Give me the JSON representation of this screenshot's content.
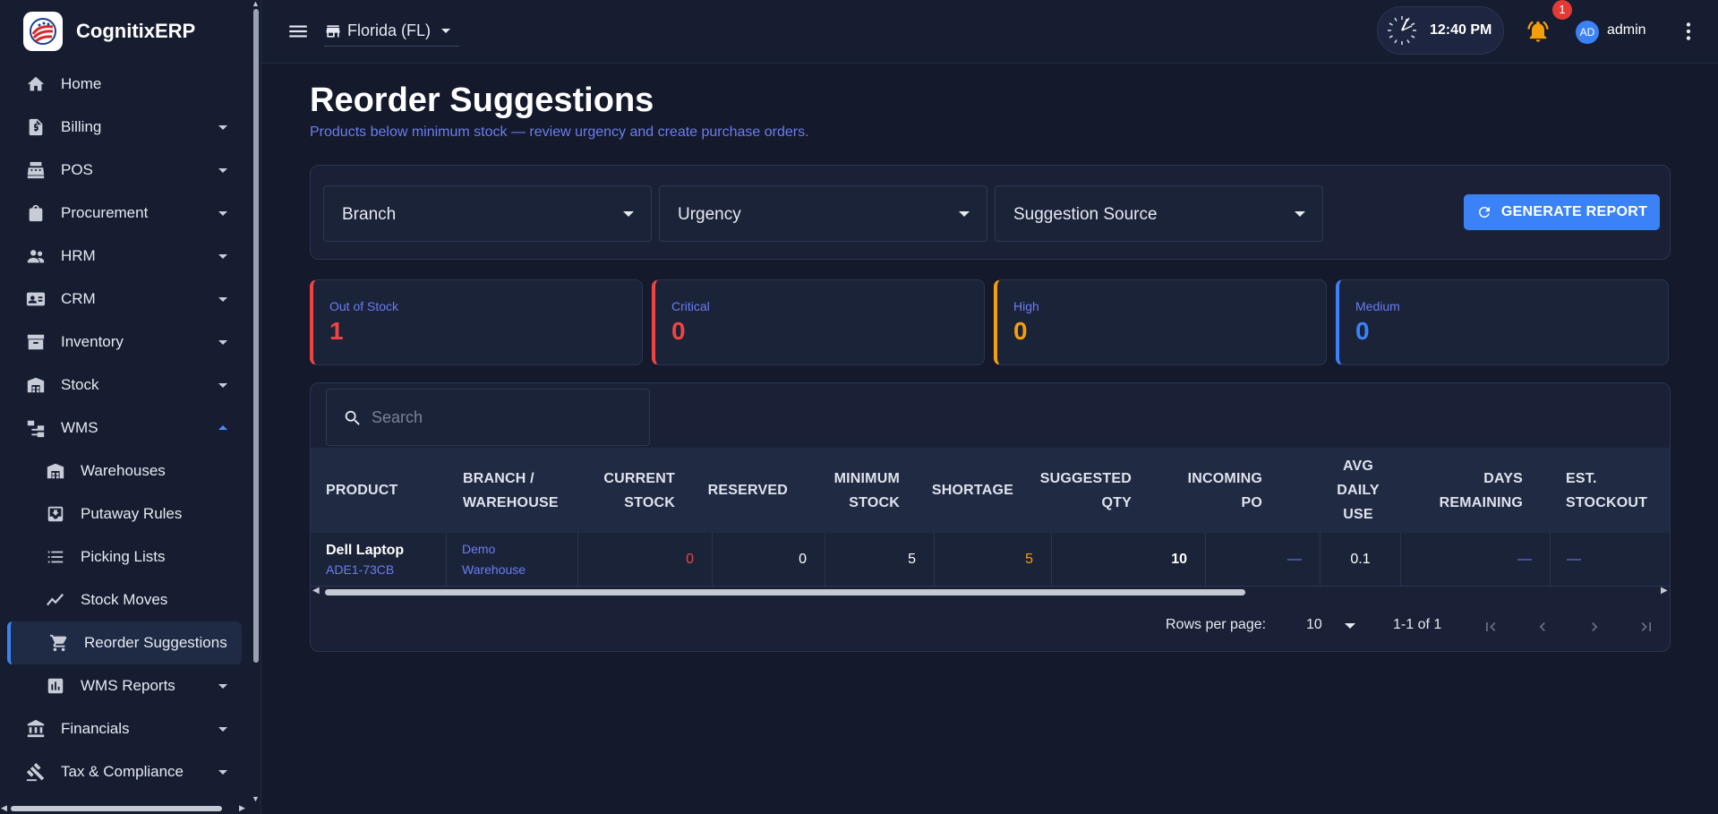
{
  "app": {
    "name": "CognitixERP"
  },
  "header": {
    "branch": "Florida (FL)",
    "time": "12:40 PM",
    "notification_count": "1",
    "avatar_initials": "AD",
    "username": "admin"
  },
  "sidebar": {
    "items": [
      {
        "label": "Home",
        "icon": "home-icon"
      },
      {
        "label": "Billing",
        "icon": "invoice-icon"
      },
      {
        "label": "POS",
        "icon": "cash-register-icon"
      },
      {
        "label": "Procurement",
        "icon": "shopping-bag-icon"
      },
      {
        "label": "HRM",
        "icon": "people-icon"
      },
      {
        "label": "CRM",
        "icon": "contact-card-icon"
      },
      {
        "label": "Inventory",
        "icon": "archive-icon"
      },
      {
        "label": "Stock",
        "icon": "warehouse-icon"
      },
      {
        "label": "WMS",
        "icon": "hierarchy-icon"
      },
      {
        "label": "Warehouses",
        "icon": "warehouse-icon"
      },
      {
        "label": "Putaway Rules",
        "icon": "inbox-download-icon"
      },
      {
        "label": "Picking Lists",
        "icon": "list-icon"
      },
      {
        "label": "Stock Moves",
        "icon": "trend-line-icon"
      },
      {
        "label": "Reorder Suggestions",
        "icon": "cart-icon"
      },
      {
        "label": "WMS Reports",
        "icon": "bar-chart-icon"
      },
      {
        "label": "Financials",
        "icon": "bank-icon"
      },
      {
        "label": "Tax & Compliance",
        "icon": "gavel-icon"
      }
    ]
  },
  "page": {
    "title": "Reorder Suggestions",
    "subtitle": "Products below minimum stock — review urgency and create purchase orders."
  },
  "filters": {
    "branch_label": "Branch",
    "urgency_label": "Urgency",
    "source_label": "Suggestion Source",
    "generate_label": "GENERATE REPORT"
  },
  "summary": {
    "cards": [
      {
        "label": "Out of Stock",
        "value": "1",
        "color": "#ef4444"
      },
      {
        "label": "Critical",
        "value": "0",
        "color": "#ef4444"
      },
      {
        "label": "High",
        "value": "0",
        "color": "#f59e0b"
      },
      {
        "label": "Medium",
        "value": "0",
        "color": "#3b82f6"
      }
    ]
  },
  "table": {
    "search_placeholder": "Search",
    "columns": {
      "product": "PRODUCT",
      "branch_l1": "BRANCH /",
      "branch_l2": "WAREHOUSE",
      "current_l1": "CURRENT",
      "current_l2": "STOCK",
      "reserved": "RESERVED",
      "minimum_l1": "MINIMUM",
      "minimum_l2": "STOCK",
      "shortage": "SHORTAGE",
      "suggested_l1": "SUGGESTED",
      "suggested_l2": "QTY",
      "incoming_l1": "INCOMING",
      "incoming_l2": "PO",
      "avg_l1": "AVG",
      "avg_l2": "DAILY",
      "avg_l3": "USE",
      "days_l1": "DAYS",
      "days_l2": "REMAINING",
      "est_l1": "EST.",
      "est_l2": "STOCKOUT"
    },
    "rows": [
      {
        "product": "Dell Laptop",
        "sku": "ADE1-73CB",
        "branch_l1": "Demo",
        "branch_l2": "Warehouse",
        "current_stock": "0",
        "reserved": "0",
        "minimum_stock": "5",
        "shortage": "5",
        "suggested_qty": "10",
        "incoming_po": "—",
        "avg_daily_use": "0.1",
        "days_remaining": "—",
        "est_stockout": "—"
      }
    ]
  },
  "pagination": {
    "rows_per_page_label": "Rows per page:",
    "rows_per_page": "10",
    "range": "1-1 of 1"
  }
}
